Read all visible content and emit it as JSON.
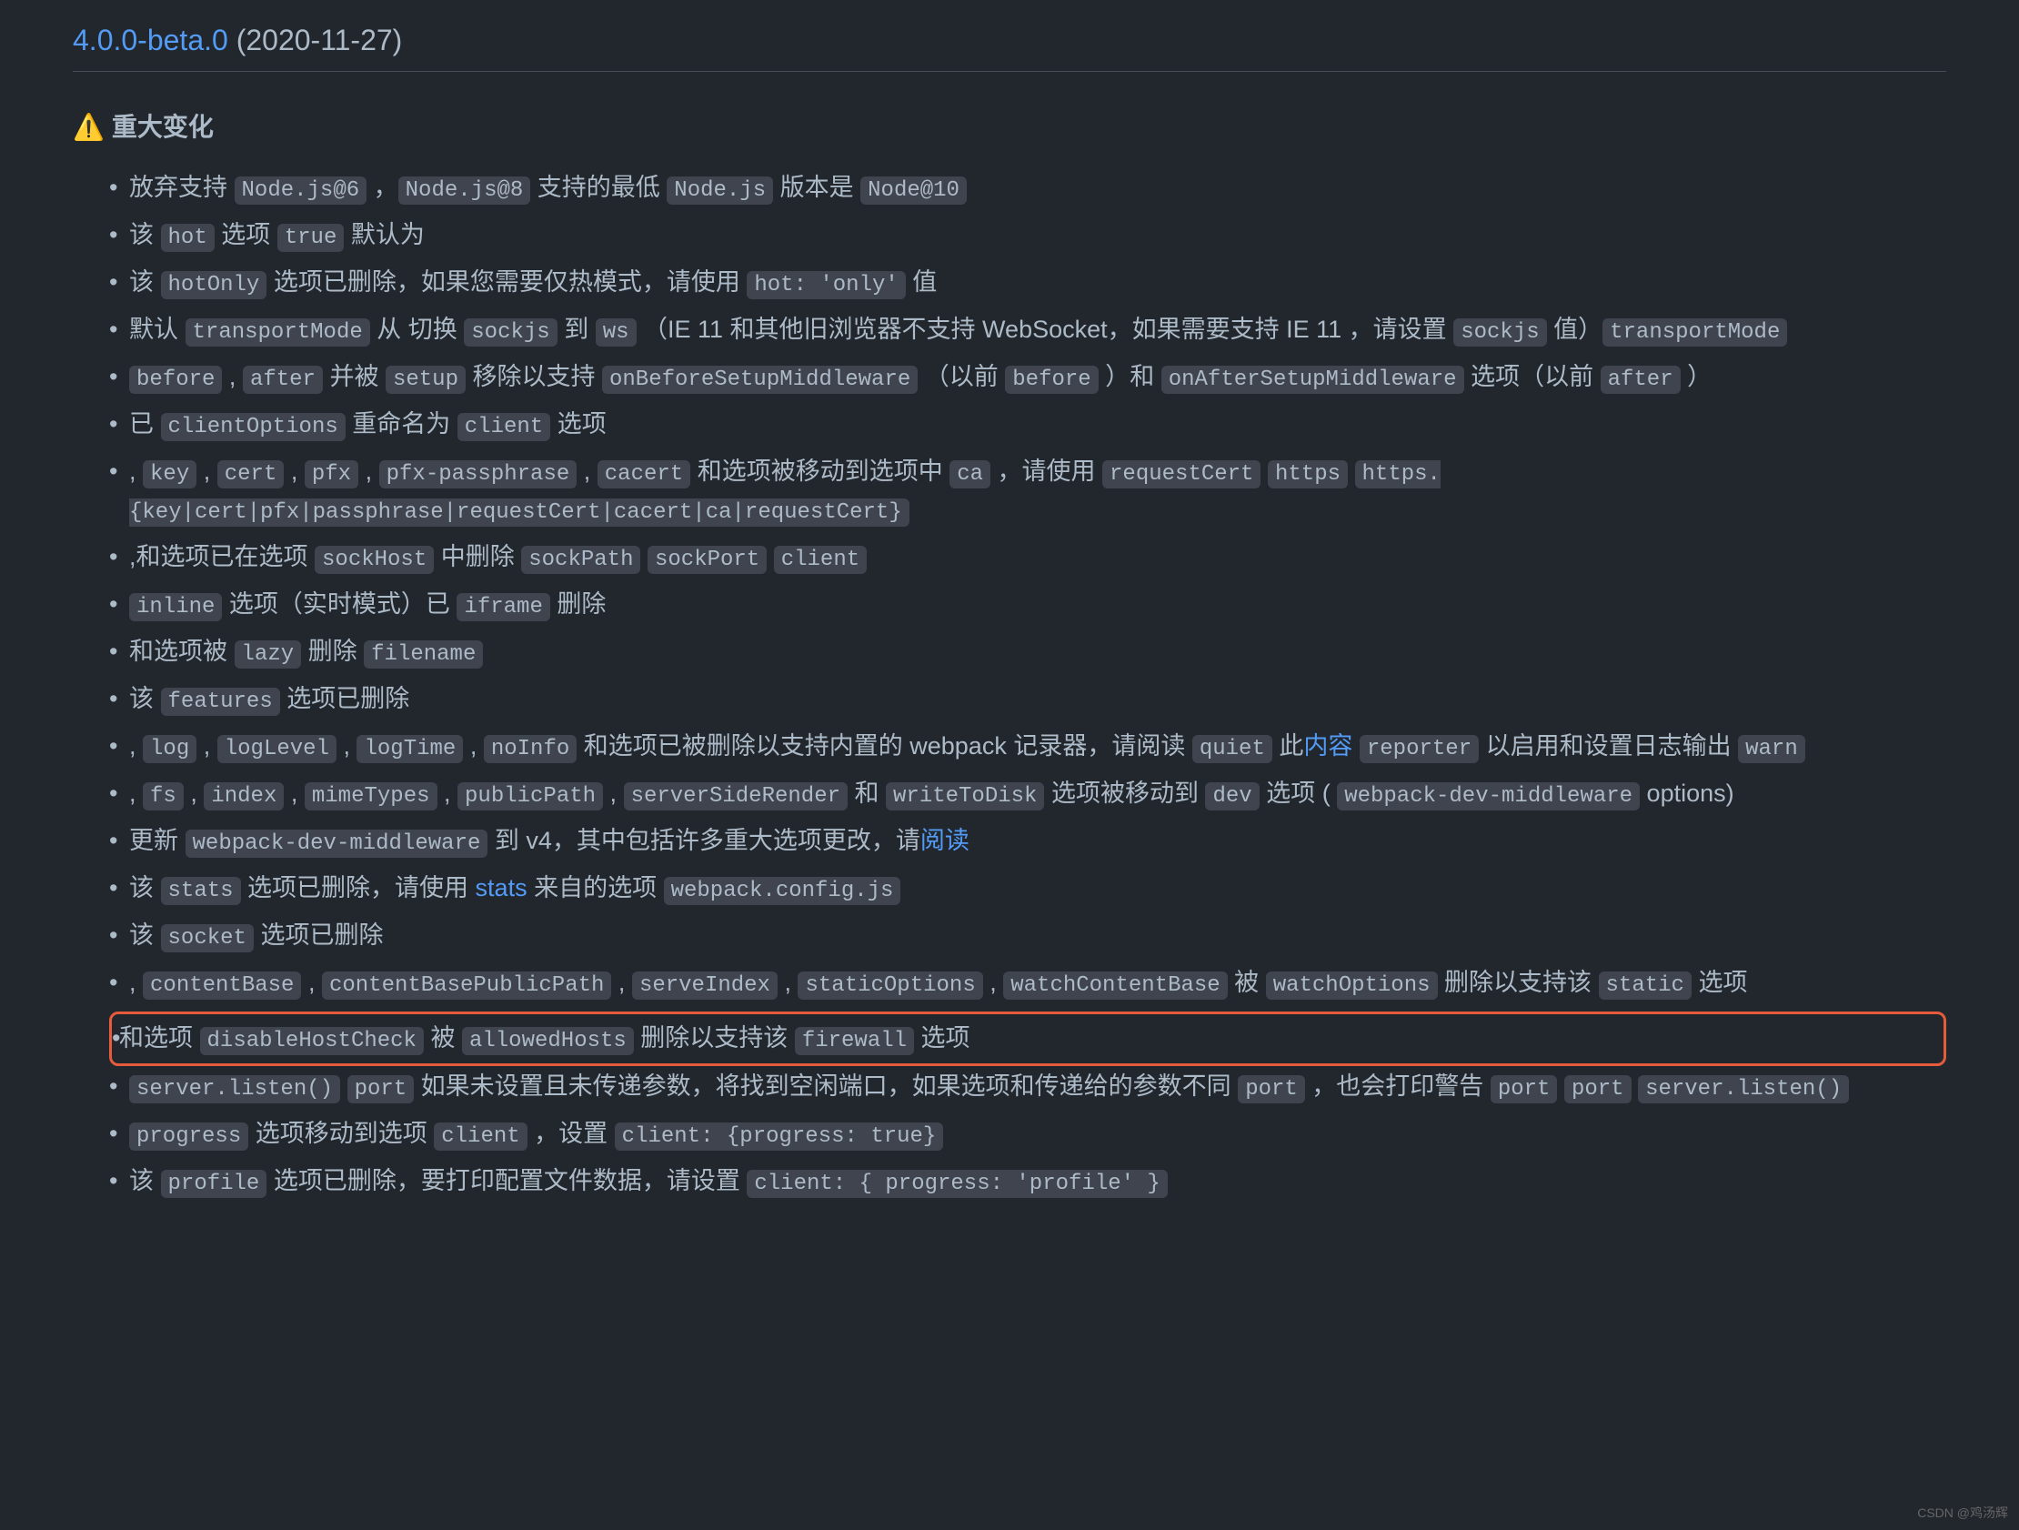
{
  "version_link": "4.0.0-beta.0",
  "version_date": " (2020-11-27)",
  "warning_emoji": "⚠️",
  "section_title": "重大变化",
  "items": [
    {
      "parts": [
        {
          "t": "text",
          "v": "放弃支持 "
        },
        {
          "t": "code",
          "v": "Node.js@6"
        },
        {
          "t": "text",
          "v": " ，"
        },
        {
          "t": "code",
          "v": "Node.js@8"
        },
        {
          "t": "text",
          "v": " 支持的最低 "
        },
        {
          "t": "code",
          "v": "Node.js"
        },
        {
          "t": "text",
          "v": " 版本是 "
        },
        {
          "t": "code",
          "v": "Node@10"
        }
      ]
    },
    {
      "parts": [
        {
          "t": "text",
          "v": "该 "
        },
        {
          "t": "code",
          "v": "hot"
        },
        {
          "t": "text",
          "v": " 选项 "
        },
        {
          "t": "code",
          "v": "true"
        },
        {
          "t": "text",
          "v": " 默认为"
        }
      ]
    },
    {
      "parts": [
        {
          "t": "text",
          "v": "该 "
        },
        {
          "t": "code",
          "v": "hotOnly"
        },
        {
          "t": "text",
          "v": " 选项已删除，如果您需要仅热模式，请使用 "
        },
        {
          "t": "code",
          "v": "hot: 'only'"
        },
        {
          "t": "text",
          "v": " 值"
        }
      ]
    },
    {
      "parts": [
        {
          "t": "text",
          "v": "默认 "
        },
        {
          "t": "code",
          "v": "transportMode"
        },
        {
          "t": "text",
          "v": " 从 切换 "
        },
        {
          "t": "code",
          "v": "sockjs"
        },
        {
          "t": "text",
          "v": " 到 "
        },
        {
          "t": "code",
          "v": "ws"
        },
        {
          "t": "text",
          "v": " （IE 11 和其他旧浏览器不支持 WebSocket，如果需要支持 IE 11 ，请设置 "
        },
        {
          "t": "code",
          "v": "sockjs"
        },
        {
          "t": "text",
          "v": " 值）"
        },
        {
          "t": "code",
          "v": "transportMode"
        }
      ]
    },
    {
      "parts": [
        {
          "t": "code",
          "v": "before"
        },
        {
          "t": "text",
          "v": " , "
        },
        {
          "t": "code",
          "v": "after"
        },
        {
          "t": "text",
          "v": " 并被 "
        },
        {
          "t": "code",
          "v": "setup"
        },
        {
          "t": "text",
          "v": " 移除以支持 "
        },
        {
          "t": "code",
          "v": "onBeforeSetupMiddleware"
        },
        {
          "t": "text",
          "v": " （以前 "
        },
        {
          "t": "code",
          "v": "before"
        },
        {
          "t": "text",
          "v": " ）和 "
        },
        {
          "t": "code",
          "v": "onAfterSetupMiddleware"
        },
        {
          "t": "text",
          "v": " 选项（以前 "
        },
        {
          "t": "code",
          "v": "after"
        },
        {
          "t": "text",
          "v": " ）"
        }
      ]
    },
    {
      "parts": [
        {
          "t": "text",
          "v": "已 "
        },
        {
          "t": "code",
          "v": "clientOptions"
        },
        {
          "t": "text",
          "v": " 重命名为 "
        },
        {
          "t": "code",
          "v": "client"
        },
        {
          "t": "text",
          "v": " 选项"
        }
      ]
    },
    {
      "parts": [
        {
          "t": "text",
          "v": ", "
        },
        {
          "t": "code",
          "v": "key"
        },
        {
          "t": "text",
          "v": " , "
        },
        {
          "t": "code",
          "v": "cert"
        },
        {
          "t": "text",
          "v": " , "
        },
        {
          "t": "code",
          "v": "pfx"
        },
        {
          "t": "text",
          "v": " , "
        },
        {
          "t": "code",
          "v": "pfx-passphrase"
        },
        {
          "t": "text",
          "v": " , "
        },
        {
          "t": "code",
          "v": "cacert"
        },
        {
          "t": "text",
          "v": " 和选项被移动到选项中 "
        },
        {
          "t": "code",
          "v": "ca"
        },
        {
          "t": "text",
          "v": " ，请使用 "
        },
        {
          "t": "code",
          "v": "requestCert"
        },
        {
          "t": "text",
          "v": " "
        },
        {
          "t": "code",
          "v": "https"
        },
        {
          "t": "text",
          "v": " "
        },
        {
          "t": "code",
          "v": "https.{key|cert|pfx|passphrase|requestCert|cacert|ca|requestCert}"
        }
      ]
    },
    {
      "parts": [
        {
          "t": "text",
          "v": ",和选项已在选项 "
        },
        {
          "t": "code",
          "v": "sockHost"
        },
        {
          "t": "text",
          "v": " 中删除 "
        },
        {
          "t": "code",
          "v": "sockPath"
        },
        {
          "t": "text",
          "v": " "
        },
        {
          "t": "code",
          "v": "sockPort"
        },
        {
          "t": "text",
          "v": " "
        },
        {
          "t": "code",
          "v": "client"
        }
      ]
    },
    {
      "parts": [
        {
          "t": "code",
          "v": "inline"
        },
        {
          "t": "text",
          "v": " 选项（实时模式）已 "
        },
        {
          "t": "code",
          "v": "iframe"
        },
        {
          "t": "text",
          "v": " 删除"
        }
      ]
    },
    {
      "parts": [
        {
          "t": "text",
          "v": "和选项被 "
        },
        {
          "t": "code",
          "v": "lazy"
        },
        {
          "t": "text",
          "v": " 删除 "
        },
        {
          "t": "code",
          "v": "filename"
        }
      ]
    },
    {
      "parts": [
        {
          "t": "text",
          "v": "该 "
        },
        {
          "t": "code",
          "v": "features"
        },
        {
          "t": "text",
          "v": " 选项已删除"
        }
      ]
    },
    {
      "parts": [
        {
          "t": "text",
          "v": ", "
        },
        {
          "t": "code",
          "v": "log"
        },
        {
          "t": "text",
          "v": " , "
        },
        {
          "t": "code",
          "v": "logLevel"
        },
        {
          "t": "text",
          "v": " , "
        },
        {
          "t": "code",
          "v": "logTime"
        },
        {
          "t": "text",
          "v": " , "
        },
        {
          "t": "code",
          "v": "noInfo"
        },
        {
          "t": "text",
          "v": " 和选项已被删除以支持内置的 webpack 记录器，请阅读 "
        },
        {
          "t": "code",
          "v": "quiet"
        },
        {
          "t": "text",
          "v": " 此"
        },
        {
          "t": "link",
          "v": "内容"
        },
        {
          "t": "text",
          "v": " "
        },
        {
          "t": "code",
          "v": "reporter"
        },
        {
          "t": "text",
          "v": " 以启用和设置日志输出 "
        },
        {
          "t": "code",
          "v": "warn"
        }
      ]
    },
    {
      "parts": [
        {
          "t": "text",
          "v": ", "
        },
        {
          "t": "code",
          "v": "fs"
        },
        {
          "t": "text",
          "v": " , "
        },
        {
          "t": "code",
          "v": "index"
        },
        {
          "t": "text",
          "v": " , "
        },
        {
          "t": "code",
          "v": "mimeTypes"
        },
        {
          "t": "text",
          "v": " , "
        },
        {
          "t": "code",
          "v": "publicPath"
        },
        {
          "t": "text",
          "v": " , "
        },
        {
          "t": "code",
          "v": "serverSideRender"
        },
        {
          "t": "text",
          "v": " 和 "
        },
        {
          "t": "code",
          "v": "writeToDisk"
        },
        {
          "t": "text",
          "v": " 选项被移动到 "
        },
        {
          "t": "code",
          "v": "dev"
        },
        {
          "t": "text",
          "v": " 选项 ( "
        },
        {
          "t": "code",
          "v": "webpack-dev-middleware"
        },
        {
          "t": "text",
          "v": " options)"
        }
      ]
    },
    {
      "parts": [
        {
          "t": "text",
          "v": "更新 "
        },
        {
          "t": "code",
          "v": "webpack-dev-middleware"
        },
        {
          "t": "text",
          "v": " 到 v4，其中包括许多重大选项更改，请"
        },
        {
          "t": "link",
          "v": "阅读"
        }
      ]
    },
    {
      "parts": [
        {
          "t": "text",
          "v": "该 "
        },
        {
          "t": "code",
          "v": "stats"
        },
        {
          "t": "text",
          "v": " 选项已删除，请使用 "
        },
        {
          "t": "link",
          "v": "stats"
        },
        {
          "t": "text",
          "v": " 来自的选项 "
        },
        {
          "t": "code",
          "v": "webpack.config.js"
        }
      ]
    },
    {
      "parts": [
        {
          "t": "text",
          "v": "该 "
        },
        {
          "t": "code",
          "v": "socket"
        },
        {
          "t": "text",
          "v": " 选项已删除"
        }
      ]
    },
    {
      "parts": [
        {
          "t": "text",
          "v": ", "
        },
        {
          "t": "code",
          "v": "contentBase"
        },
        {
          "t": "text",
          "v": " , "
        },
        {
          "t": "code",
          "v": "contentBasePublicPath"
        },
        {
          "t": "text",
          "v": " , "
        },
        {
          "t": "code",
          "v": "serveIndex"
        },
        {
          "t": "text",
          "v": " , "
        },
        {
          "t": "code",
          "v": "staticOptions"
        },
        {
          "t": "text",
          "v": " , "
        },
        {
          "t": "code",
          "v": "watchContentBase"
        },
        {
          "t": "text",
          "v": " 被 "
        },
        {
          "t": "code",
          "v": "watchOptions"
        },
        {
          "t": "text",
          "v": " 删除以支持该 "
        },
        {
          "t": "code",
          "v": "static"
        },
        {
          "t": "text",
          "v": " 选项"
        }
      ]
    },
    {
      "highlight": true,
      "parts": [
        {
          "t": "text",
          "v": "和选项 "
        },
        {
          "t": "code",
          "v": "disableHostCheck"
        },
        {
          "t": "text",
          "v": " 被 "
        },
        {
          "t": "code",
          "v": "allowedHosts"
        },
        {
          "t": "text",
          "v": " 删除以支持该 "
        },
        {
          "t": "code",
          "v": "firewall"
        },
        {
          "t": "text",
          "v": " 选项"
        }
      ]
    },
    {
      "parts": [
        {
          "t": "code",
          "v": "server.listen()"
        },
        {
          "t": "text",
          "v": " "
        },
        {
          "t": "code",
          "v": "port"
        },
        {
          "t": "text",
          "v": " 如果未设置且未传递参数，将找到空闲端口，如果选项和传递给的参数不同 "
        },
        {
          "t": "code",
          "v": "port"
        },
        {
          "t": "text",
          "v": " ，也会打印警告 "
        },
        {
          "t": "code",
          "v": "port"
        },
        {
          "t": "text",
          "v": " "
        },
        {
          "t": "code",
          "v": "port"
        },
        {
          "t": "text",
          "v": " "
        },
        {
          "t": "code",
          "v": "server.listen()"
        }
      ]
    },
    {
      "parts": [
        {
          "t": "code",
          "v": "progress"
        },
        {
          "t": "text",
          "v": " 选项移动到选项 "
        },
        {
          "t": "code",
          "v": "client"
        },
        {
          "t": "text",
          "v": " ，设置 "
        },
        {
          "t": "code",
          "v": "client: {progress: true}"
        }
      ]
    },
    {
      "parts": [
        {
          "t": "text",
          "v": "该 "
        },
        {
          "t": "code",
          "v": "profile"
        },
        {
          "t": "text",
          "v": " 选项已删除，要打印配置文件数据，请设置 "
        },
        {
          "t": "code",
          "v": "client: { progress: 'profile' }"
        }
      ]
    }
  ],
  "watermark": "CSDN @鸡汤辉"
}
